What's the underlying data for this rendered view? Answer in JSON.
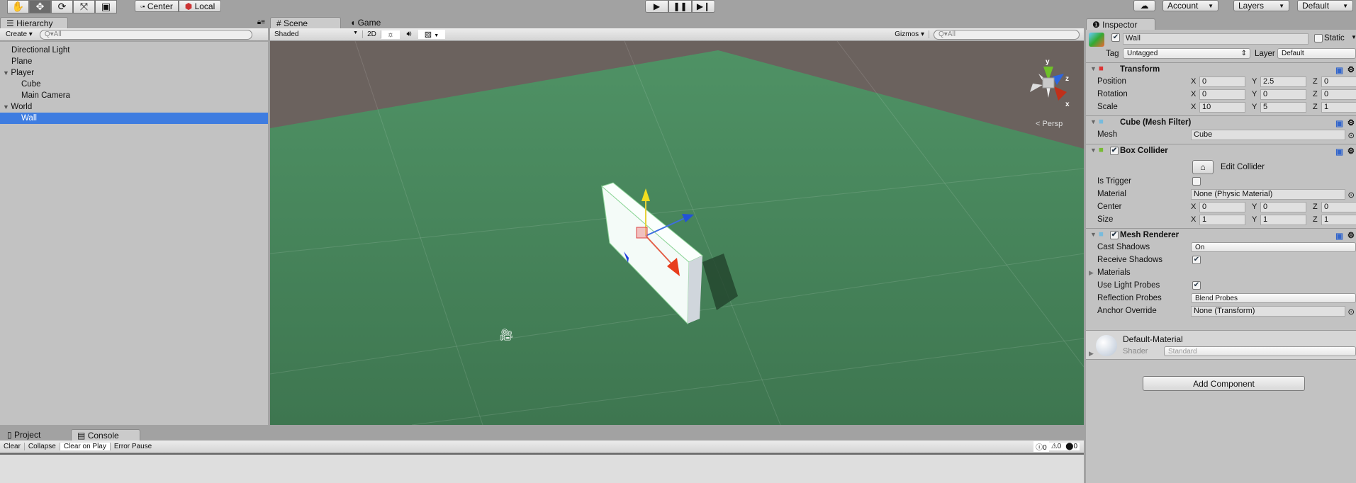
{
  "toolbar": {
    "tools": [
      "hand-tool",
      "move-tool",
      "rotate-tool",
      "scale-tool",
      "rect-tool"
    ],
    "pivot": "Center",
    "space": "Local",
    "account": "Account",
    "layers": "Layers",
    "layout": "Default"
  },
  "hierarchy": {
    "title": "Hierarchy",
    "create": "Create",
    "search": "All",
    "items": [
      {
        "label": "Directional Light",
        "indent": 0,
        "arrow": false,
        "selected": false
      },
      {
        "label": "Plane",
        "indent": 0,
        "arrow": false,
        "selected": false
      },
      {
        "label": "Player",
        "indent": 0,
        "arrow": true,
        "selected": false
      },
      {
        "label": "Cube",
        "indent": 1,
        "arrow": false,
        "selected": false
      },
      {
        "label": "Main Camera",
        "indent": 1,
        "arrow": false,
        "selected": false
      },
      {
        "label": "World",
        "indent": 0,
        "arrow": true,
        "selected": false
      },
      {
        "label": "Wall",
        "indent": 1,
        "arrow": false,
        "selected": true
      }
    ]
  },
  "scene": {
    "tab": "Scene",
    "game_tab": "Game",
    "shading": "Shaded",
    "mode2d": "2D",
    "gizmos": "Gizmos",
    "search": "All",
    "persp": "Persp",
    "axes": {
      "y": "y",
      "z": "z",
      "x": "x"
    }
  },
  "bottom": {
    "project_tab": "Project",
    "console_tab": "Console",
    "clear": "Clear",
    "collapse": "Collapse",
    "clear_on_play": "Clear on Play",
    "error_pause": "Error Pause",
    "info_count": "0",
    "warn_count": "0",
    "error_count": "0"
  },
  "inspector": {
    "title": "Inspector",
    "name": "Wall",
    "static": "Static",
    "tag_label": "Tag",
    "tag": "Untagged",
    "layer_label": "Layer",
    "layer": "Default",
    "transform": {
      "title": "Transform",
      "position": {
        "label": "Position",
        "x": "0",
        "y": "2.5",
        "z": "0"
      },
      "rotation": {
        "label": "Rotation",
        "x": "0",
        "y": "0",
        "z": "0"
      },
      "scale": {
        "label": "Scale",
        "x": "10",
        "y": "5",
        "z": "1"
      }
    },
    "mesh_filter": {
      "title": "Cube (Mesh Filter)",
      "mesh_label": "Mesh",
      "mesh": "Cube"
    },
    "box_collider": {
      "title": "Box Collider",
      "edit": "Edit Collider",
      "is_trigger": "Is Trigger",
      "material_label": "Material",
      "material": "None (Physic Material)",
      "center": {
        "label": "Center",
        "x": "0",
        "y": "0",
        "z": "0"
      },
      "size": {
        "label": "Size",
        "x": "1",
        "y": "1",
        "z": "1"
      }
    },
    "mesh_renderer": {
      "title": "Mesh Renderer",
      "cast_label": "Cast Shadows",
      "cast": "On",
      "receive_label": "Receive Shadows",
      "materials": "Materials",
      "light_probes": "Use Light Probes",
      "reflection_label": "Reflection Probes",
      "reflection": "Blend Probes",
      "anchor_label": "Anchor Override",
      "anchor": "None (Transform)"
    },
    "material": {
      "name": "Default-Material",
      "shader_label": "Shader",
      "shader": "Standard"
    },
    "add_component": "Add Component"
  },
  "colors": {
    "selection": "#3e7ce0",
    "scene_ground": "#4a8a5e",
    "scene_sky": "#6b625e"
  }
}
